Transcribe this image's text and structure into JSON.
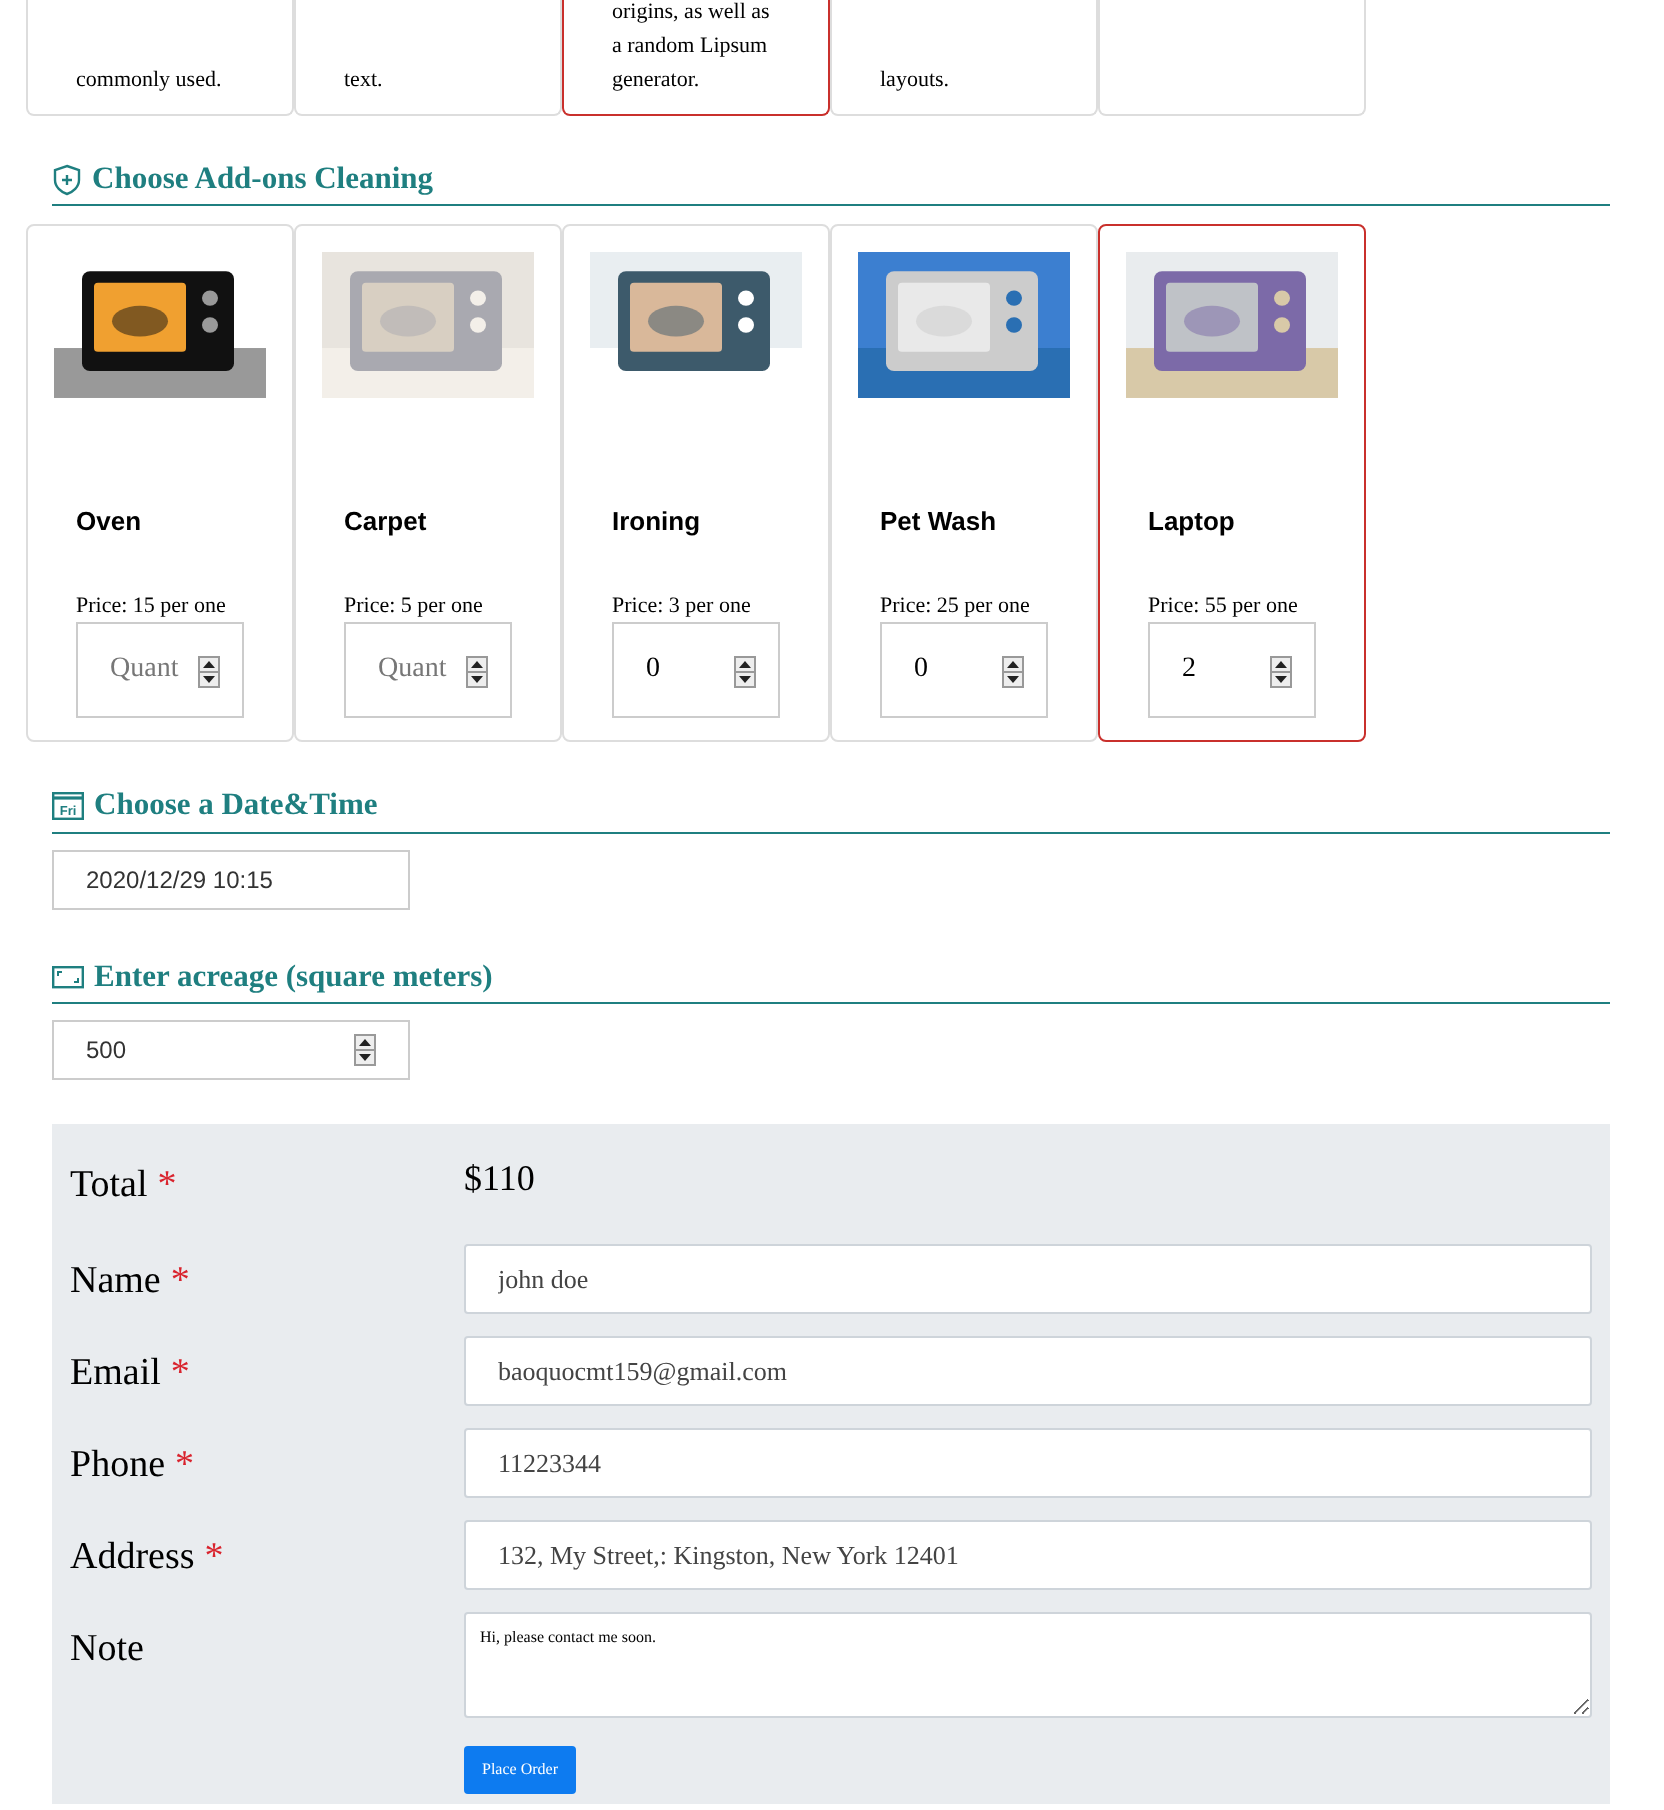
{
  "top_cards": [
    {
      "lines": [
        "commonly used."
      ],
      "selected": false
    },
    {
      "lines": [
        "text."
      ],
      "selected": false
    },
    {
      "lines": [
        "origins, as well as",
        "a random Lipsum",
        "generator."
      ],
      "selected": true
    },
    {
      "lines": [
        "layouts."
      ],
      "selected": false
    },
    {
      "selected": false
    }
  ],
  "addons_section": {
    "title": "Choose Add-ons Cleaning",
    "items": [
      {
        "name": "Oven",
        "price": "Price: 15 per one",
        "quantity": {
          "placeholder": "Quant"
        },
        "selected": false
      },
      {
        "name": "Carpet",
        "price": "Price: 5 per one",
        "quantity": {
          "placeholder": "Quant"
        },
        "selected": false
      },
      {
        "name": "Ironing",
        "price": "Price: 3 per one",
        "quantity": {
          "value": "0"
        },
        "selected": false
      },
      {
        "name": "Pet Wash",
        "price": "Price: 25 per one",
        "quantity": {
          "value": "0"
        },
        "selected": false
      },
      {
        "name": "Laptop",
        "price": "Price: 55 per one",
        "quantity": {
          "value": "2"
        },
        "selected": true
      }
    ]
  },
  "date_section": {
    "title": "Choose a Date&Time",
    "icon_text": "Fri",
    "value": "2020/12/29 10:15"
  },
  "acreage_section": {
    "title": "Enter acreage (square meters)",
    "value": "500"
  },
  "order_form": {
    "total": {
      "label": "Total",
      "required_mark": "*",
      "value": "$110"
    },
    "fields": [
      {
        "kind": "input",
        "label": "Name",
        "required_mark": "*",
        "value": "john doe"
      },
      {
        "kind": "input",
        "label": "Email",
        "required_mark": "*",
        "value": "baoquocmt159@gmail.com"
      },
      {
        "kind": "input",
        "label": "Phone",
        "required_mark": "*",
        "value": "11223344"
      },
      {
        "kind": "input",
        "label": "Address",
        "required_mark": "*",
        "value": "132, My Street,: Kingston, New York 12401"
      },
      {
        "kind": "textarea",
        "label": "Note",
        "value": "Hi, please contact me soon."
      }
    ],
    "submit": "Place Order"
  }
}
